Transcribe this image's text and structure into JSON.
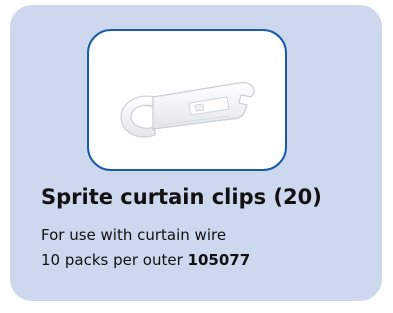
{
  "product": {
    "title": "Sprite curtain clips (20)",
    "description": "For use with curtain wire",
    "packs_prefix": "10 packs per outer",
    "product_code": "105077"
  },
  "image": {
    "icon": "curtain-clip-icon"
  },
  "colors": {
    "card_background": "#cdd8ee",
    "frame_border": "#1a5ba8",
    "text": "#111111"
  }
}
